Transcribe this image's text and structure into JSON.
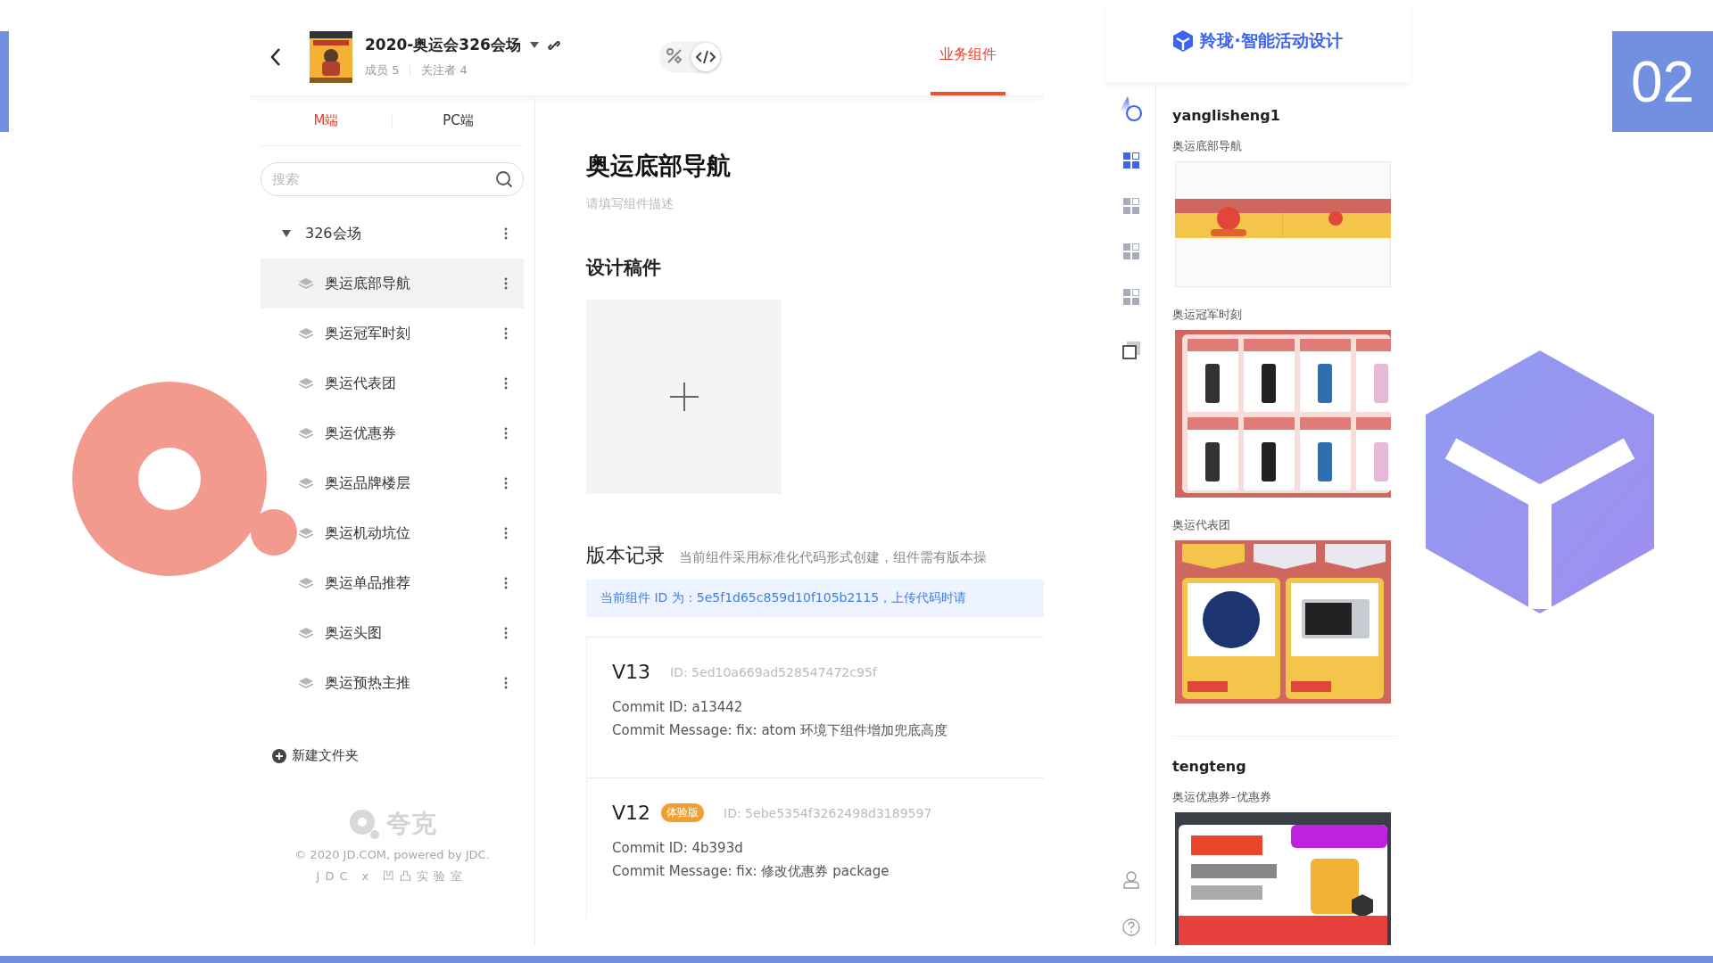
{
  "slide": {
    "badge": "02"
  },
  "app": {
    "header": {
      "title": "2020-奥运会326会场",
      "members": "成员 5",
      "followers": "关注者 4",
      "mode": [
        {
          "kind": "design",
          "selected": false
        },
        {
          "kind": "code",
          "selected": true
        }
      ],
      "tabs": [
        {
          "label": "业务组件",
          "selected": true
        }
      ]
    },
    "sidebar": {
      "tabs": [
        {
          "label": "M端",
          "selected": true
        },
        {
          "label": "PC端",
          "selected": false
        }
      ],
      "search": {
        "placeholder": "搜索"
      },
      "tree": [
        {
          "label": "326会场",
          "expanded": true,
          "children": [
            {
              "label": "奥运底部导航",
              "selected": true
            },
            {
              "label": "奥运冠军时刻",
              "selected": false
            },
            {
              "label": "奥运代表团",
              "selected": false
            },
            {
              "label": "奥运优惠券",
              "selected": false
            },
            {
              "label": "奥运品牌楼层",
              "selected": false
            },
            {
              "label": "奥运机动坑位",
              "selected": false
            },
            {
              "label": "奥运单品推荐",
              "selected": false
            },
            {
              "label": "奥运头图",
              "selected": false
            },
            {
              "label": "奥运预热主推",
              "selected": false
            }
          ]
        }
      ],
      "new_folder": "新建文件夹",
      "footer": {
        "logo": "夸克",
        "copyright": "© 2020 JD.COM, powered by JDC.",
        "credit": "JDC x 凹凸实验室"
      }
    },
    "content": {
      "title": "奥运底部导航",
      "description": {
        "placeholder": "请填写组件描述"
      },
      "design_heading": "设计稿件",
      "versions_heading": "版本记录",
      "versions_note": "当前组件采用标准化代码形式创建，组件需有版本操",
      "id_banner": "当前组件 ID 为：5e5f1d65c859d10f105b2115，上传代码时请",
      "versions": [
        {
          "version": "V13",
          "id": "ID: 5ed10a669ad528547472c95f",
          "commit_id": "Commit ID: a13442",
          "commit_message": "Commit Message: fix: atom 环境下组件增加兜底高度"
        },
        {
          "version": "V12",
          "tag": "体验版",
          "id": "ID: 5ebe5354f3262498d3189597",
          "commit_id": "Commit ID: 4b393d",
          "commit_message": "Commit Message: fix: 修改优惠券 package"
        }
      ]
    }
  },
  "gallery": {
    "brand": "羚珑·智能活动设计",
    "rail": [
      {
        "selected": true
      },
      {
        "selected": false
      },
      {
        "selected": false
      },
      {
        "selected": false
      }
    ],
    "groups": [
      {
        "user": "yanglisheng1",
        "components": [
          {
            "name": "奥运底部导航"
          },
          {
            "name": "奥运冠军时刻"
          },
          {
            "name": "奥运代表团"
          }
        ]
      },
      {
        "user": "tengteng",
        "components": [
          {
            "name": "奥运优惠券–优惠券"
          }
        ]
      }
    ]
  }
}
